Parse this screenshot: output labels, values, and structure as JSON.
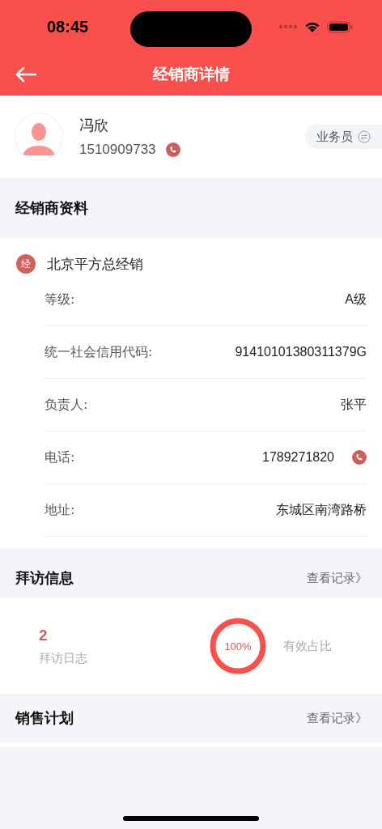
{
  "status_bar": {
    "time": "08:45"
  },
  "nav": {
    "title": "经销商详情"
  },
  "profile": {
    "name": "冯欣",
    "phone": "1510909733",
    "role": "业务员"
  },
  "dealer_section": {
    "title": "经销商资料",
    "badge": "经",
    "name": "北京平方总经销",
    "rows": [
      {
        "kind": "text",
        "label": "等级:",
        "value": "A级"
      },
      {
        "kind": "text",
        "label": "统一社会信用代码:",
        "value": "91410101380311379G"
      },
      {
        "kind": "text",
        "label": "负责人:",
        "value": "张平"
      },
      {
        "kind": "phone",
        "label": "电话:",
        "value": "1789271820"
      },
      {
        "kind": "text",
        "label": "地址:",
        "value": "东城区南湾路桥"
      }
    ]
  },
  "visit_section": {
    "title": "拜访信息",
    "link": "查看记录》",
    "log_count": "2",
    "log_label": "拜访日志",
    "ratio": {
      "level": 1,
      "reading": "100%",
      "label": "有效占比"
    }
  },
  "sales_section": {
    "title": "销售计划",
    "link": "查看记录》"
  }
}
